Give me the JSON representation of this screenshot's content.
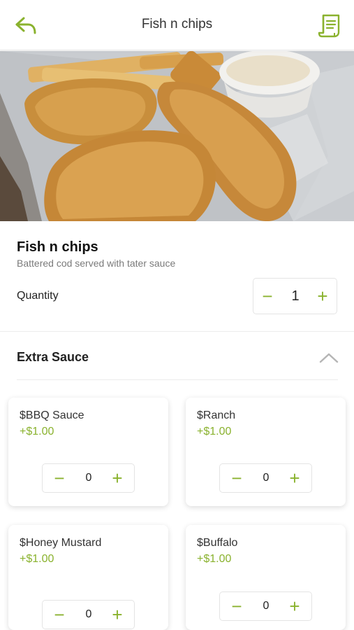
{
  "header": {
    "title": "Fish n chips",
    "back_icon": "reply-arrow-icon",
    "receipt_icon": "receipt-icon"
  },
  "colors": {
    "accent": "#8ab22e",
    "text": "#1e1e1e",
    "muted": "#7a7a7a"
  },
  "item": {
    "name": "Fish n chips",
    "description": "Battered cod served with tater sauce",
    "quantity_label": "Quantity",
    "quantity": "1",
    "minus_symbol": "−",
    "plus_symbol": "+"
  },
  "extras": {
    "title": "Extra Sauce",
    "toggle_icon": "chevron-up-icon",
    "options": [
      {
        "name": "$BBQ Sauce",
        "price": "+$1.00",
        "count": "0"
      },
      {
        "name": "$Ranch",
        "price": "+$1.00",
        "count": "0"
      },
      {
        "name": "$Honey Mustard",
        "price": "+$1.00",
        "count": "0"
      },
      {
        "name": "$Buffalo",
        "price": "+$1.00",
        "count": "0"
      }
    ]
  }
}
